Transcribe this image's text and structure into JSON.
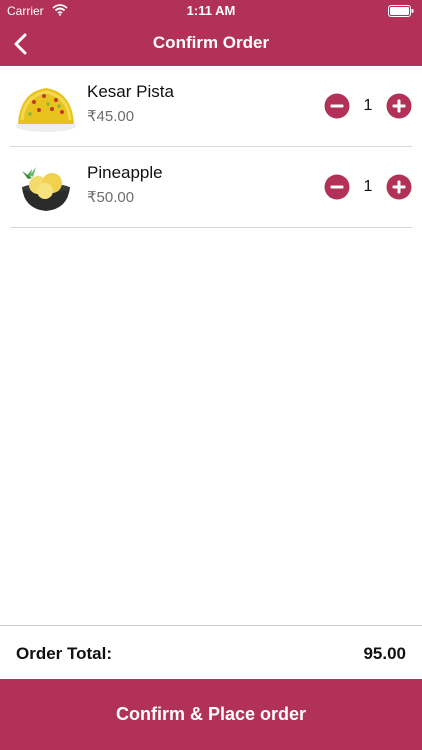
{
  "status_bar": {
    "carrier": "Carrier",
    "time": "1:11 AM"
  },
  "nav": {
    "title": "Confirm Order",
    "back_icon": "chevron-left-icon"
  },
  "colors": {
    "brand": "#b13158",
    "price_text": "#6d6d6d"
  },
  "items": [
    {
      "name": "Kesar Pista",
      "price": "₹45.00",
      "quantity": "1",
      "image": "kesar-pista-dish-image"
    },
    {
      "name": "Pineapple",
      "price": "₹50.00",
      "quantity": "1",
      "image": "pineapple-dessert-image"
    }
  ],
  "footer": {
    "total_label": "Order Total:",
    "total_value": "95.00",
    "confirm_label": "Confirm & Place order"
  }
}
